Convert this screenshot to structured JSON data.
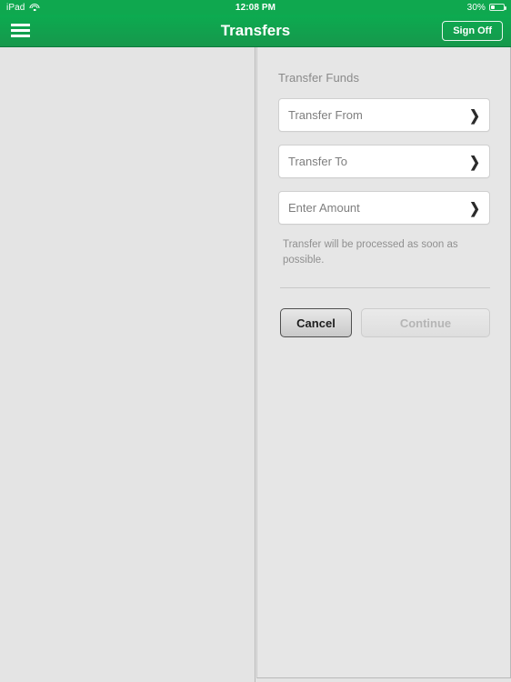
{
  "status_bar": {
    "device_label": "iPad",
    "wifi_icon": "wifi-icon",
    "time": "12:08 PM",
    "battery_percent": "30%",
    "battery_level": 30,
    "battery_icon": "battery-icon"
  },
  "nav_bar": {
    "menu_icon": "hamburger-menu-icon",
    "title": "Transfers",
    "sign_off_label": "Sign Off",
    "background_start": "#0cab50",
    "background_end": "#16984c"
  },
  "transfer_form": {
    "section_title": "Transfer Funds",
    "fields": [
      {
        "label": "Transfer From",
        "chevron": "❯"
      },
      {
        "label": "Transfer To",
        "chevron": "❯"
      },
      {
        "label": "Enter Amount",
        "chevron": "❯"
      }
    ],
    "helper_text": "Transfer will be processed as soon as possible.",
    "cancel_label": "Cancel",
    "continue_label": "Continue"
  }
}
